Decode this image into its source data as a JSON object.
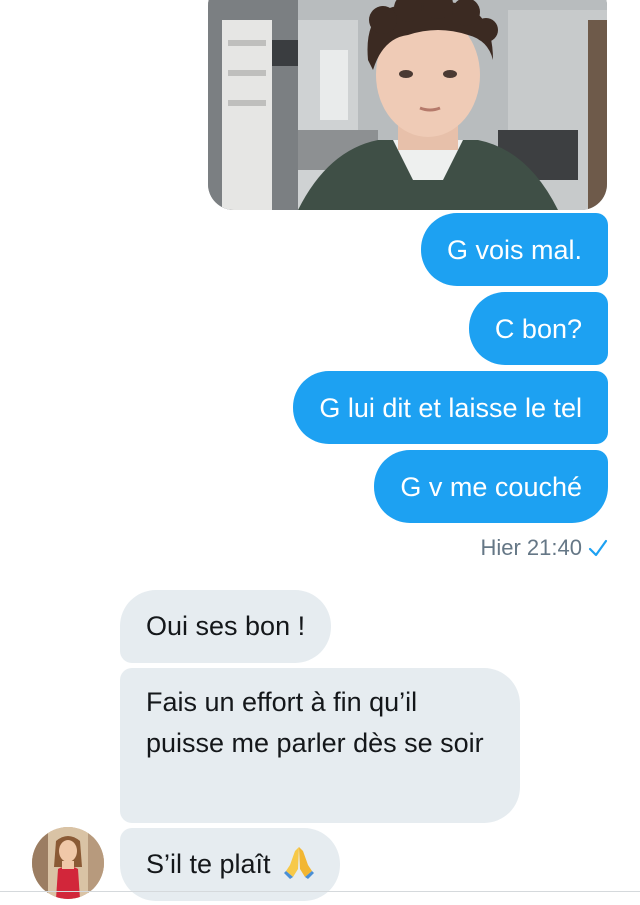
{
  "conversation": {
    "sent_messages": [
      "G vois mal.",
      "C bon?",
      "G lui dit et laisse le tel",
      "G v me couché"
    ],
    "sent_timestamp": "Hier 21:40",
    "received_messages": [
      "Oui ses bon !",
      "Fais un effort à fin qu’il puisse me parler dès se soir",
      "S’il te plaît"
    ],
    "colors": {
      "sent_bubble": "#1da1f2",
      "received_bubble": "#e6ecf0",
      "timestamp": "#657786"
    },
    "icons": {
      "read_receipt": "checkmark-icon",
      "emoji": "folded-hands-emoji-icon"
    }
  }
}
